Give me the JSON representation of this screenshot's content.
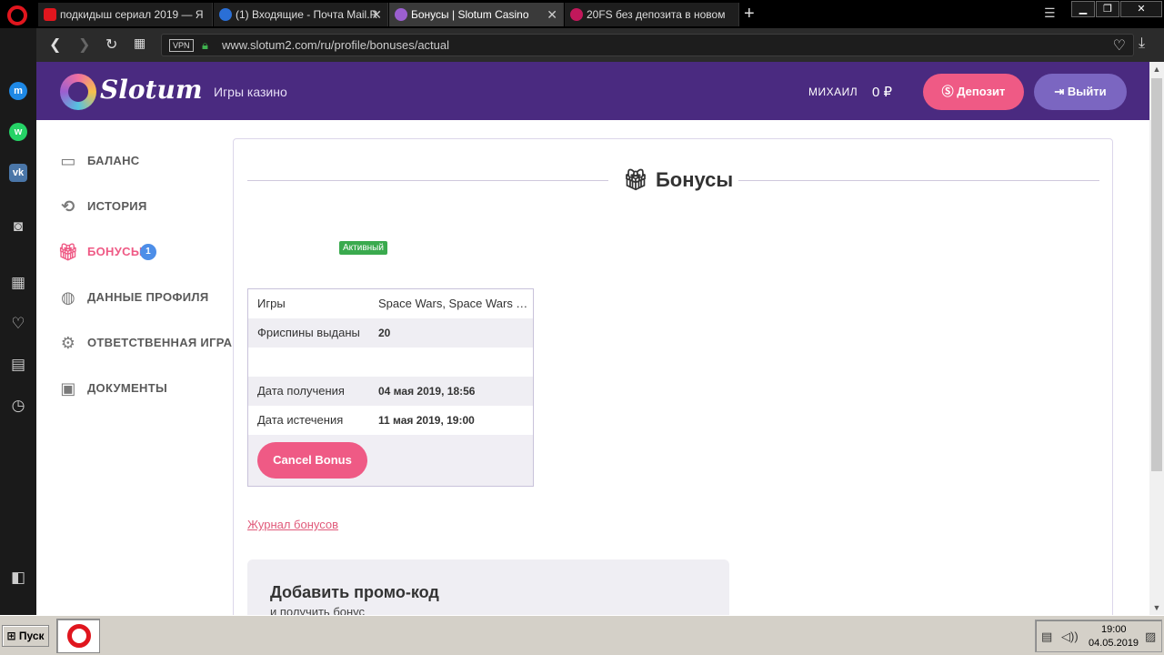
{
  "browser": {
    "tabs": [
      {
        "label": "подкидыш сериал 2019 — Я",
        "favicon_color": "#e0161e"
      },
      {
        "label": "(1) Входящие - Почта Mail.R",
        "favicon_color": "#2a6fd6"
      },
      {
        "label": "Бонусы | Slotum Casino",
        "favicon_color": "#9b5fd0"
      },
      {
        "label": "20FS без депозита в новом",
        "favicon_color": "#c2185b"
      }
    ],
    "vpn_label": "VPN",
    "url": "www.slotum2.com/ru/profile/bonuses/actual"
  },
  "site": {
    "logo": "Slotum",
    "nav_link": "Игры казино",
    "user_name": "МИХАИЛ",
    "balance": "0 ₽",
    "deposit_label": "Депозит",
    "logout_label": "Выйти"
  },
  "menu": {
    "items": [
      {
        "label": "БАЛАНС",
        "icon": "wallet-icon"
      },
      {
        "label": "ИСТОРИЯ",
        "icon": "history-icon"
      },
      {
        "label": "БОНУСЫ",
        "icon": "gift-icon",
        "badge": "1"
      },
      {
        "label": "ДАННЫЕ ПРОФИЛЯ",
        "icon": "user-icon"
      },
      {
        "label": "ОТВЕТСТВЕННАЯ ИГРА",
        "icon": "gear-icon"
      },
      {
        "label": "ДОКУМЕНТЫ",
        "icon": "id-card-icon"
      }
    ]
  },
  "bonuses": {
    "title": "Бонусы",
    "status": "Активный",
    "rows": [
      {
        "key": "Игры",
        "value": "Space Wars, Space Wars Touch"
      },
      {
        "key": "Фриспины выданы",
        "value": "20"
      },
      {
        "key": "",
        "value": ""
      },
      {
        "key": "Дата получения",
        "value": "04 мая 2019, 18:56"
      },
      {
        "key": "Дата истечения",
        "value": "11 мая 2019, 19:00"
      }
    ],
    "cancel_label": "Cancel Bonus",
    "journal_link": "Журнал бонусов",
    "promo_title": "Добавить промо-код",
    "promo_sub": "и получить бонус"
  },
  "taskbar": {
    "start_label": "Пуск",
    "time": "19:00",
    "date": "04.05.2019"
  },
  "colors": {
    "brand_purple": "#4a2a80",
    "accent_pink": "#ef5a85",
    "active_green": "#3aaa4e"
  }
}
